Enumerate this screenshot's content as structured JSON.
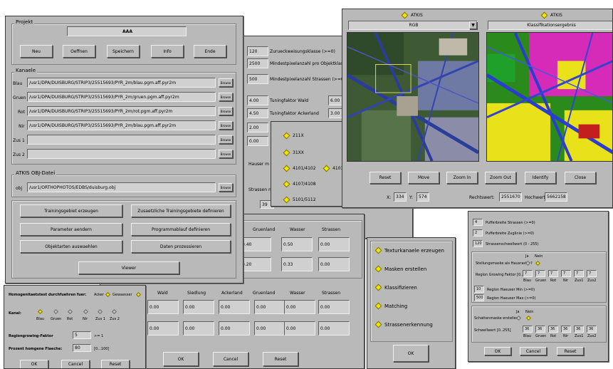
{
  "main": {
    "projekt_label": "Projekt",
    "project_name": "AAA",
    "buttons": [
      "Neu",
      "Oeffnen",
      "Speichern",
      "Info",
      "Ende"
    ],
    "kanaele_label": "Kanaele",
    "channels": [
      {
        "name": "Blau",
        "path": "/usr1/DPA/DUISBURG/STRIP3/25515693/PYR_2m/blau.pgm.aff.pyr2m"
      },
      {
        "name": "Gruen",
        "path": "/usr1/DPA/DUISBURG/STRIP3/25515693/PYR_2m/gruen.pgm.aff.pyr2m"
      },
      {
        "name": "Rot",
        "path": "/usr1/DPA/DUISBURG/STRIP3/25515693/PYR_2m/rot.pgm.aff.pyr2m"
      },
      {
        "name": "Nir",
        "path": "/usr1/DPA/DUISBURG/STRIP3/25515693/PYR_2m/blau.pgm.aff.pyr2m"
      },
      {
        "name": "Zus 1",
        "path": ""
      },
      {
        "name": "Zus 2",
        "path": ""
      }
    ],
    "browse": "Browse",
    "atkis_label": "ATKIS OBJ-Datei",
    "obj_label": "obj",
    "obj_path": "/usr1/ORTHOPHOTOS/EDBS/duisburg.obj",
    "actions": [
      "Trainingsgebiet erzeugen",
      "Zusaetzliche Trainingsgebiete definieren",
      "Parameter aendern",
      "Programmablauf definieren",
      "Objektarten auswaehlen",
      "Daten prozessieren"
    ],
    "viewer": "Viewer"
  },
  "params": {
    "rows": [
      {
        "v": "120",
        "t": "Zurueckweisungsklasse (>=0)"
      },
      {
        "v": "2500",
        "t": "Mindestpixelanzahl pro Objektklasse"
      },
      {
        "v": "500",
        "t": "Mindestpixelanzahl Strassen (>=0)"
      }
    ],
    "tune": [
      {
        "v": "4.00",
        "t": "Tuningfaktor Wald",
        "v2": "6.00"
      },
      {
        "v": "4.50",
        "t": "Tuningfaktor Ackerland",
        "v2": "3.00"
      },
      {
        "v": "2.00"
      },
      {
        "v": "0.00"
      }
    ],
    "hauser": "Hauser m",
    "strassen": "Strassen n",
    "small_val": "39",
    "ok": "OK",
    "cancel": "Cancel",
    "reset": "Reset"
  },
  "codes": [
    "211X",
    "31XX",
    "4101/4102",
    "4103",
    "4107/4108",
    "5101/5112"
  ],
  "gridwin": {
    "cols": [
      "Wald",
      "Siedlung",
      "Ackerland",
      "Gruenland",
      "Wasser",
      "Strassen"
    ],
    "row_top": [
      "",
      "",
      "",
      "0.40",
      "0.50",
      "0.00"
    ],
    "row_mid": [
      "",
      "",
      "",
      "0.20",
      "0.33",
      "0.00"
    ],
    "row_a": [
      "0.00",
      "0.00",
      "0.00",
      "0.00",
      "0.00",
      "0.00"
    ],
    "row_b": [
      "0.00",
      "0.00",
      "0.00",
      "0.00",
      "0.00",
      "0.00"
    ]
  },
  "viewer": {
    "left_title": "ATKIS",
    "right_title": "ATKIS",
    "left_select": "RGB",
    "right_select": "Klassifikationsergebnis",
    "buttons": [
      "Reset",
      "Move",
      "Zoom In",
      "Zoom Out",
      "Identify",
      "Close"
    ],
    "x_label": "X:",
    "x_val": "334",
    "y_label": "Y:",
    "y_val": "574",
    "rw_label": "Rechtswert:",
    "rw_val": "2551670",
    "hw_label": "Hochwert:",
    "hw_val": "5662158"
  },
  "steps": {
    "items": [
      "Texturkanaele erzeugen",
      "Masken erstellen",
      "Klassifizieren",
      "Matching",
      "Strassenerkennung"
    ],
    "ok": "OK"
  },
  "homog": {
    "title": "Homogenitaetstest durchfuehren fuer:",
    "acker": "Acker",
    "gewaesser": "Gewaesser",
    "kanal": "Kanal:",
    "channels": [
      "Blau",
      "Gruen",
      "Rot",
      "Nir",
      "Zus 1",
      "Zus 2"
    ],
    "rg_label": "Regiongrowing-Faktor",
    "rg_val": "5",
    "rg_hint": ">= 1",
    "ph_label": "Prozent homgene Flaeche:",
    "ph_val": "80",
    "ph_hint": "[0...100]",
    "ok": "OK",
    "cancel": "Cancel",
    "reset": "Reset"
  },
  "road": {
    "r1v": "4",
    "r1": "Pufferbreite Strassen (>=0)",
    "r2v": "2",
    "r2": "Pufferbreite Zuglinie (>=0)",
    "r3v": "120",
    "r3": "Strassenschwellwert (0 - 255)",
    "ja": "Ja",
    "nein": "Nein",
    "hmask": "Stellungsmaske als Hausraster?",
    "rg": "Region Growing Faktor [0..255]",
    "rgv": [
      "7",
      "7",
      "7",
      "7",
      "7",
      "7"
    ],
    "chan": [
      "Blau",
      "Gruen",
      "Rot",
      "Nir",
      "Zus1",
      "Zus2"
    ],
    "hmin_v": "10",
    "hmin": "Region Haeuser Min (>=0)",
    "hmax_v": "500",
    "hmax": "Region Haeuser Max (>=0)",
    "shadow": "Schattenmaske erstellen?",
    "sw": "Schwellwert [0..255]",
    "swv": [
      "36",
      "36",
      "36",
      "36",
      "36",
      "36"
    ],
    "ok": "OK",
    "cancel": "Cancel",
    "reset": "Reset"
  }
}
